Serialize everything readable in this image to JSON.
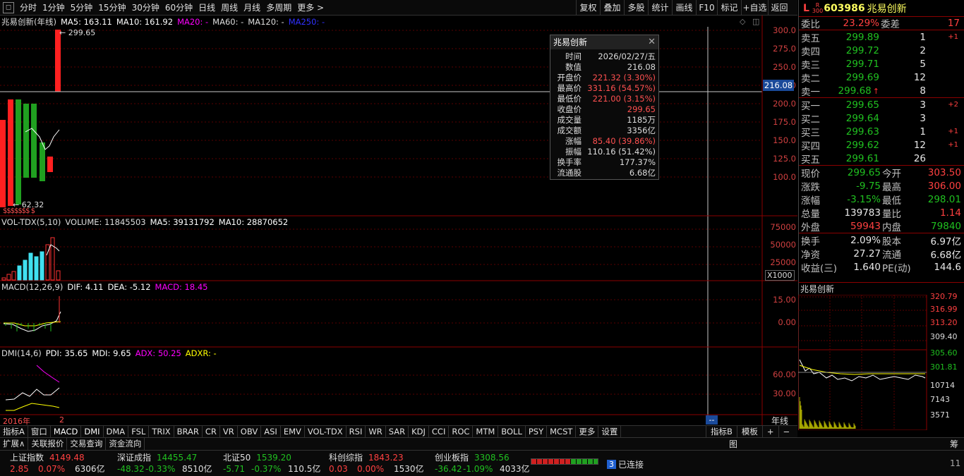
{
  "toolbar": {
    "corner": "◻",
    "periods": [
      "分时",
      "1分钟",
      "5分钟",
      "15分钟",
      "30分钟",
      "60分钟",
      "日线",
      "周线",
      "月线",
      "多周期"
    ],
    "more": "更多 >",
    "right_buttons": [
      "复权",
      "叠加",
      "多股",
      "统计",
      "画线",
      "F10",
      "标记",
      "+自选",
      "返回"
    ]
  },
  "main_chart": {
    "name": "兆易创新(年线)",
    "ma5": "MA5: 163.11",
    "ma10": "MA10: 161.92",
    "ma20": "MA20: -",
    "ma60": "MA60: -",
    "ma120": "MA120: -",
    "ma250": "MA250: -",
    "high_label": "299.65",
    "low_label": "62.32",
    "dividend_marks": "$$$$$$$  $",
    "y_ticks": [
      "300.0",
      "275.0",
      "250.0",
      "225.0",
      "200.0",
      "175.0",
      "150.0",
      "125.0",
      "100.0"
    ],
    "crosshair_value": "216.08"
  },
  "volume_panel": {
    "name": "VOL-TDX(5,10)",
    "volume": "VOLUME: 11845503",
    "ma5": "MA5: 39131792",
    "ma10": "MA10: 28870652",
    "y_ticks": [
      "75000",
      "50000",
      "25000"
    ],
    "multiplier": "X1000"
  },
  "macd_panel": {
    "name": "MACD(12,26,9)",
    "dif": "DIF: 4.11",
    "dea": "DEA: -5.12",
    "macd": "MACD: 18.45",
    "y_ticks": [
      "15.00",
      "0.00"
    ]
  },
  "dmi_panel": {
    "name": "DMI(14,6)",
    "pdi": "PDI: 35.65",
    "mdi": "MDI: 9.65",
    "adx": "ADX: 50.25",
    "adxr": "ADXR: -",
    "y_ticks": [
      "60.00",
      "30.00"
    ]
  },
  "x_axis": {
    "start": "2016年",
    "mark": "2",
    "cursor": "--",
    "period_label": "年线"
  },
  "popup": {
    "title": "兆易创新",
    "close": "✕",
    "rows": [
      {
        "label": "时间",
        "value": "2026/02/27/五",
        "color": "#dddddd"
      },
      {
        "label": "数值",
        "value": "216.08",
        "color": "#dddddd"
      },
      {
        "label": "开盘价",
        "value": "221.32 (3.30%)",
        "color": "#ff5050"
      },
      {
        "label": "最高价",
        "value": "331.16 (54.57%)",
        "color": "#ff5050"
      },
      {
        "label": "最低价",
        "value": "221.00 (3.15%)",
        "color": "#ff5050"
      },
      {
        "label": "收盘价",
        "value": "299.65",
        "color": "#ff5050"
      },
      {
        "label": "成交量",
        "value": "1185万",
        "color": "#dddddd"
      },
      {
        "label": "成交额",
        "value": "3356亿",
        "color": "#dddddd"
      },
      {
        "label": "涨幅",
        "value": "85.40 (39.86%)",
        "color": "#ff5050"
      },
      {
        "label": "振幅",
        "value": "110.16 (51.42%)",
        "color": "#dddddd"
      },
      {
        "label": "换手率",
        "value": "177.37%",
        "color": "#dddddd"
      },
      {
        "label": "流通股",
        "value": "6.68亿",
        "color": "#dddddd"
      }
    ]
  },
  "quote": {
    "flag": "L",
    "badge_top": "R",
    "badge_bottom": "300",
    "code": "603986",
    "name": "兆易创新",
    "weibi_label": "委比",
    "weibi_value": "23.29%",
    "weicha_label": "委差",
    "weicha_value": "17",
    "asks": [
      {
        "label": "卖五",
        "price": "299.89",
        "vol": "1",
        "chg": "+1"
      },
      {
        "label": "卖四",
        "price": "299.72",
        "vol": "2",
        "chg": ""
      },
      {
        "label": "卖三",
        "price": "299.71",
        "vol": "5",
        "chg": ""
      },
      {
        "label": "卖二",
        "price": "299.69",
        "vol": "12",
        "chg": ""
      },
      {
        "label": "卖一",
        "price": "299.68",
        "vol": "8",
        "chg": "",
        "arrow": "↑"
      }
    ],
    "bids": [
      {
        "label": "买一",
        "price": "299.65",
        "vol": "3",
        "chg": "+2"
      },
      {
        "label": "买二",
        "price": "299.64",
        "vol": "3",
        "chg": ""
      },
      {
        "label": "买三",
        "price": "299.63",
        "vol": "1",
        "chg": "+1"
      },
      {
        "label": "买四",
        "price": "299.62",
        "vol": "12",
        "chg": "+1"
      },
      {
        "label": "买五",
        "price": "299.61",
        "vol": "26",
        "chg": ""
      }
    ],
    "stats": [
      {
        "l1": "现价",
        "v1": "299.65",
        "c1": "#20c020",
        "l2": "今开",
        "v2": "303.50",
        "c2": "#ff4040"
      },
      {
        "l1": "涨跌",
        "v1": "-9.75",
        "c1": "#20c020",
        "l2": "最高",
        "v2": "306.00",
        "c2": "#ff4040"
      },
      {
        "l1": "涨幅",
        "v1": "-3.15%",
        "c1": "#20c020",
        "l2": "最低",
        "v2": "298.01",
        "c2": "#20c020"
      },
      {
        "l1": "总量",
        "v1": "139783",
        "c1": "#e8e8e8",
        "l2": "量比",
        "v2": "1.14",
        "c2": "#ff4040"
      },
      {
        "l1": "外盘",
        "v1": "59943",
        "c1": "#ff4040",
        "l2": "内盘",
        "v2": "79840",
        "c2": "#20c020"
      }
    ],
    "stats2": [
      {
        "l1": "换手",
        "v1": "2.09%",
        "l2": "股本",
        "v2": "6.97亿"
      },
      {
        "l1": "净资",
        "v1": "27.27",
        "l2": "流通",
        "v2": "6.68亿"
      },
      {
        "l1": "收益(三)",
        "v1": "1.640",
        "l2": "PE(动)",
        "v2": "144.6"
      }
    ]
  },
  "mini_chart": {
    "name": "兆易创新",
    "price_ticks": [
      "320.79",
      "316.99",
      "313.20",
      "309.40",
      "305.60",
      "301.81"
    ],
    "vol_ticks": [
      "10714",
      "7143",
      "3571"
    ]
  },
  "indicator_tabs": [
    "指标A",
    "窗口",
    "MACD",
    "DMI",
    "DMA",
    "FSL",
    "TRIX",
    "BRAR",
    "CR",
    "VR",
    "OBV",
    "ASI",
    "EMV",
    "VOL-TDX",
    "RSI",
    "WR",
    "SAR",
    "KDJ",
    "CCI",
    "ROC",
    "MTM",
    "BOLL",
    "PSY",
    "MCST",
    "更多",
    "设置"
  ],
  "indicator_tabs_right": [
    "指标B",
    "模板",
    "+",
    "−"
  ],
  "ext_tabs": [
    "扩展∧",
    "关联报价",
    "交易查询",
    "资金流向"
  ],
  "ext_right": "图",
  "ext_far_right": "筹",
  "status": {
    "indices": [
      {
        "name": "上证指数",
        "value": "4149.48",
        "chg": "2.85",
        "pct": "0.07%",
        "amt": "6306亿"
      },
      {
        "name": "深证成指",
        "value": "14455.47",
        "chg": "-48.32",
        "pct": "-0.33%",
        "amt": "8510亿"
      },
      {
        "name": "北证50",
        "value": "1539.20",
        "chg": "-5.71",
        "pct": "-0.37%",
        "amt": "110.5亿"
      },
      {
        "name": "科创综指",
        "value": "1843.23",
        "chg": "0.03",
        "pct": "0.00%",
        "amt": "1530亿"
      },
      {
        "name": "创业板指",
        "value": "3308.56",
        "chg": "-36.42",
        "pct": "-1.09%",
        "amt": "4033亿"
      }
    ],
    "conn_num": "3",
    "conn_text": "已连接",
    "clock": "11"
  },
  "colors": {
    "up": "#ff3232",
    "down": "#20c020",
    "cyan": "#40e0f0",
    "magenta": "#ff00ff",
    "ma5": "#ffffff",
    "ma10": "#ffff00"
  }
}
